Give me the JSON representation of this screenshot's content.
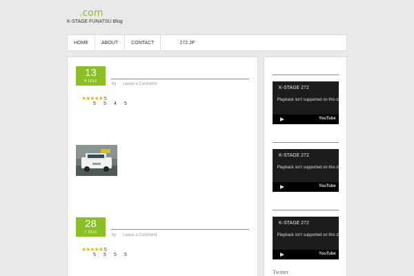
{
  "header": {
    "site_title": ".com",
    "site_description": "K-STAGE FUNATSU Blog"
  },
  "nav": {
    "items": [
      "HOME",
      "ABOUT",
      "CONTACT"
    ],
    "extra": "272.JP"
  },
  "posts": [
    {
      "day": "13",
      "month_year": "8   2016",
      "by": "by",
      "sep": ":",
      "comment_link": "Leave a Comment",
      "stars": "★★★★★",
      "star_count": "5",
      "ratings": [
        "5",
        "5",
        "4",
        "5"
      ],
      "thumbnail": "white-suv-photo"
    },
    {
      "day": "28",
      "month_year": "7   2016",
      "by": "by",
      "sep": ":",
      "comment_link": "Leave a Comment",
      "stars": "★★★★★",
      "star_count": "5",
      "ratings": [
        "5",
        "5",
        "5",
        "5"
      ]
    }
  ],
  "sidebar": {
    "videos": [
      {
        "title": "K-STAGE 272",
        "message": "Playback isn't supported on this device.",
        "logo": "YouTube"
      },
      {
        "title": "K-STAGE 272",
        "message": "Playback isn't supported on this device.",
        "logo": "YouTube"
      },
      {
        "title": "K-STAGE 272",
        "message": "Playback isn't supported on this device.",
        "logo": "YouTube"
      }
    ],
    "twitter_heading": "Twitter"
  },
  "colors": {
    "accent": "#8cbf26",
    "background": "#e9e9e9",
    "video_bg": "#1c1c1c",
    "star": "#e6b400"
  }
}
